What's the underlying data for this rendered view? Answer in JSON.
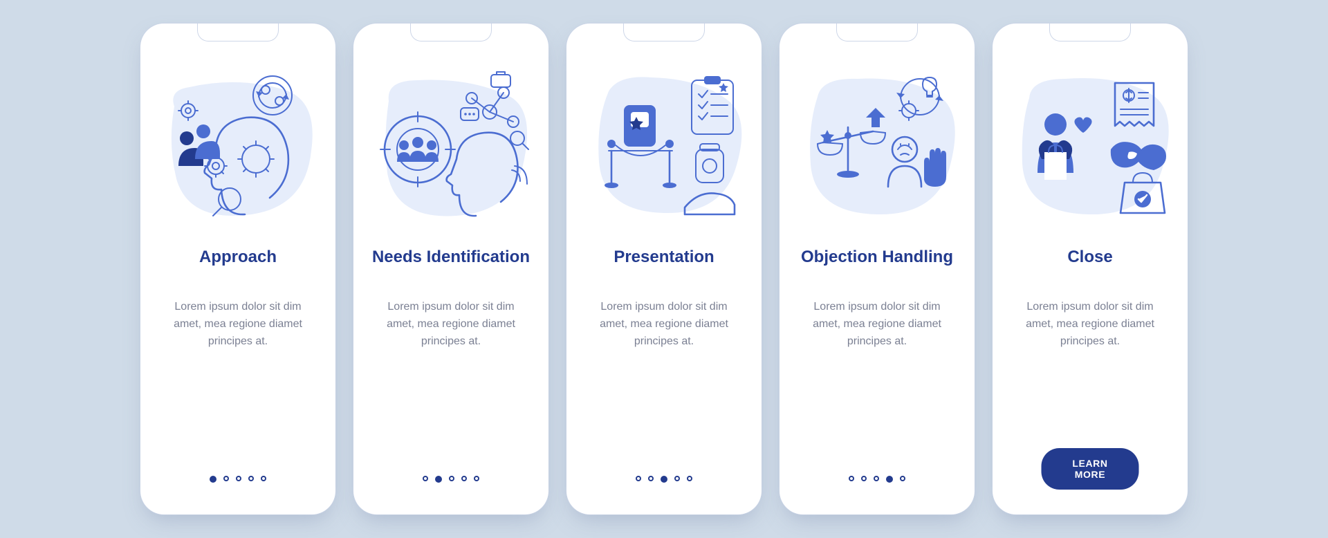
{
  "common": {
    "body": "Lorem ipsum dolor sit dim amet, mea regione diamet principes at.",
    "learn_more": "LEARN MORE"
  },
  "screens": [
    {
      "title": "Approach",
      "illustration": "approach-icon",
      "active_dot": 0,
      "show_cta": false
    },
    {
      "title": "Needs Identification",
      "illustration": "needs-identification-icon",
      "active_dot": 1,
      "show_cta": false
    },
    {
      "title": "Presentation",
      "illustration": "presentation-icon",
      "active_dot": 2,
      "show_cta": false
    },
    {
      "title": "Objection Handling",
      "illustration": "objection-handling-icon",
      "active_dot": 3,
      "show_cta": false
    },
    {
      "title": "Close",
      "illustration": "close-icon",
      "active_dot": 4,
      "show_cta": true
    }
  ],
  "colors": {
    "accent_dark": "#233b8e",
    "accent_mid": "#4b6dd1",
    "illus_light": "#e6edfb",
    "page_bg": "#cfdbe8"
  }
}
